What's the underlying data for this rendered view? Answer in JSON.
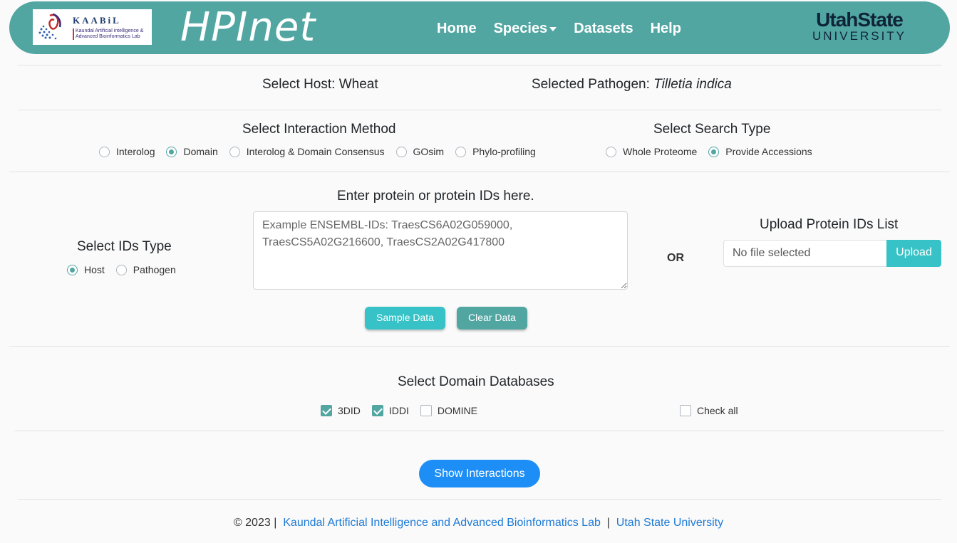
{
  "header": {
    "logo_title": "KAABiL",
    "logo_subtitle": "Kaundal Artificial intelligence & Advanced Bioinformatics Lab",
    "brand": "HPInet",
    "nav": [
      {
        "label": "Home"
      },
      {
        "label": "Species"
      },
      {
        "label": "Datasets"
      },
      {
        "label": "Help"
      }
    ],
    "usu_top": "UtahState",
    "usu_bottom": "UNIVERSITY"
  },
  "selection": {
    "host_text": "Select Host: Wheat",
    "pathogen_prefix": "Selected Pathogen: ",
    "pathogen_name": "Tilletia indica"
  },
  "interaction": {
    "title": "Select Interaction Method",
    "options": [
      "Interolog",
      "Domain",
      "Interolog & Domain Consensus",
      "GOsim",
      "Phylo-profiling"
    ],
    "selected": "Domain"
  },
  "search_type": {
    "title": "Select Search Type",
    "options": [
      "Whole Proteome",
      "Provide Accessions"
    ],
    "selected": "Provide Accessions"
  },
  "ids_type": {
    "title": "Select IDs Type",
    "options": [
      "Host",
      "Pathogen"
    ],
    "selected": "Host"
  },
  "protein_input": {
    "title": "Enter protein or protein IDs here.",
    "placeholder": "Example ENSEMBL-IDs: TraesCS6A02G059000, TraesCS5A02G216600, TraesCS2A02G417800",
    "sample_button": "Sample Data",
    "clear_button": "Clear Data"
  },
  "or_label": "OR",
  "upload": {
    "title": "Upload Protein IDs List",
    "file_status": "No file selected",
    "button": "Upload"
  },
  "domain_db": {
    "title": "Select Domain Databases",
    "options": [
      {
        "label": "3DID",
        "checked": true
      },
      {
        "label": "IDDI",
        "checked": true
      },
      {
        "label": "DOMINE",
        "checked": false
      }
    ],
    "check_all": "Check all"
  },
  "show_button": "Show Interactions",
  "footer": {
    "copyright": "© 2023 |",
    "lab_link": "Kaundal Artificial Intelligence and Advanced Bioinformatics Lab",
    "separator": "|",
    "usu_link": "Utah State University"
  },
  "colors": {
    "nav_bg": "#52a6a2",
    "accent": "#52a6a2",
    "sample_btn": "#36c2c6",
    "clear_btn": "#52a6a2",
    "show_btn": "#1e8ef7",
    "link": "#1e7ad6"
  }
}
